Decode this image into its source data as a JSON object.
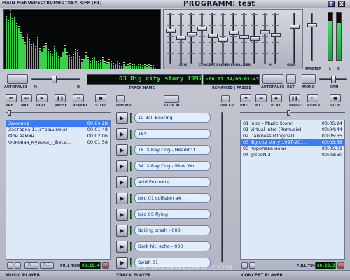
{
  "titlebar": {
    "main_menu": "MAIN MENU",
    "spectrum": "SPECTRUM",
    "hotkey": "HOTKEY: OFF (F1)",
    "program": "PROGRAMM: test",
    "help_btn": "?",
    "close_btn": "X"
  },
  "spectrum": {
    "levels": [
      0.86,
      0.78,
      0.95,
      0.82,
      0.88,
      0.74,
      0.69,
      0.58,
      0.5,
      0.42,
      0.55,
      0.47,
      0.38,
      0.44,
      0.35,
      0.5,
      0.31,
      0.28,
      0.34,
      0.39,
      0.3,
      0.26,
      0.22,
      0.35,
      0.29,
      0.18,
      0.2,
      0.28,
      0.36,
      0.24,
      0.19,
      0.15,
      0.22,
      0.3,
      0.27,
      0.18,
      0.12,
      0.17,
      0.24,
      0.16,
      0.1,
      0.14,
      0.2,
      0.13,
      0.09,
      0.11,
      0.16,
      0.1,
      0.07,
      0.12,
      0.09,
      0.06,
      0.08,
      0.1,
      0.06,
      0.05,
      0.07,
      0.05,
      0.04,
      0.06,
      0.04,
      0.03,
      0.05,
      0.03,
      0.04,
      0.02,
      0.03,
      0.02,
      0.03,
      0.02,
      0.02,
      0.01
    ],
    "bar_color": "#3ad04a"
  },
  "equalizer": {
    "label_low": "LOW",
    "label_name": "CONCERT PLAYER EQUALIZER",
    "label_hi": "HI",
    "label_gain": "GAIN",
    "bands": [
      0.35,
      0.5,
      0.42,
      0.3,
      0.45,
      0.55,
      0.4,
      0.48,
      0.52,
      0.38,
      0.44
    ],
    "gain": 0.25
  },
  "master": {
    "label": "MASTER",
    "left": "L",
    "right": "R",
    "level_left": 0.82,
    "level_right": 0.78
  },
  "track_row": {
    "autopause_left": "AUTOPAUSE",
    "m": "M",
    "d": "D",
    "track_name": "03 Big city story 1997-201",
    "track_label": "TRACK NAME",
    "remain_passed": "-00:01:54/00:01:43",
    "remain_label": "REMAINED | PASSED",
    "autopause_right": "AUTOPAUSE",
    "rst": "RST",
    "mono": "MONO",
    "pan": "PAN"
  },
  "music_player": {
    "title": "MUSIC PLAYER",
    "controls": [
      "PRE",
      "NXT",
      "PLAY",
      "PAUSE",
      "REPEAT",
      "STOP"
    ],
    "rows": [
      {
        "name": "Заминка",
        "time": "00:04:28",
        "selected": true
      },
      {
        "name": "Заставка 11(страшилка)",
        "time": "00:01:48",
        "selected": false
      },
      {
        "name": "Фон замин",
        "time": "00:02:06",
        "selected": false
      },
      {
        "name": "Фоновая_музыка_-_Весе...",
        "time": "00:01:58",
        "selected": false
      }
    ],
    "full_time_label": "FULL TIME",
    "full_time": "00:10:44",
    "page_1": "PL 1",
    "page_2": "PL 2"
  },
  "track_player": {
    "title": "TRACK PLAYER",
    "dim_mp": "DIM MP",
    "stop_all": "STOP ALL",
    "dim_cp": "DIM CP",
    "pads": [
      "10 Ball Bearing",
      "164",
      "18. X-Ray Dog - Headin' t",
      "34. X-Ray Dog - Wow Wo",
      "Acid Foxtrotte",
      "bird 01 collision a4",
      "bird 05 flying",
      "Boiling crash - 000",
      "Dark hit, echo - 000",
      "Swish 01"
    ]
  },
  "concert_player": {
    "title": "CONCERT PLAYER",
    "controls": [
      "PRE",
      "NXT",
      "PLAY",
      "PAUSE",
      "REPEAT",
      "STOP"
    ],
    "rows": [
      {
        "name": "01 Intro - Music Storm",
        "time": "00:05:24",
        "selected": false
      },
      {
        "name": "01 Virtual Intro (Remusix)",
        "time": "00:04:44",
        "selected": false
      },
      {
        "name": "02 Darkness (Original)",
        "time": "00:05:55",
        "selected": false
      },
      {
        "name": "03 Big city story 1997-201...",
        "time": "00:03:38",
        "selected": true
      },
      {
        "name": "03 Королева ночи",
        "time": "00:05:01",
        "selected": false
      },
      {
        "name": "04 @ctioN 2",
        "time": "00:03:50",
        "selected": false
      }
    ],
    "full_time_label": "FULL TIME",
    "full_time": "00:28:32"
  },
  "watermark": "SOFT DOWNLOAD.COM"
}
